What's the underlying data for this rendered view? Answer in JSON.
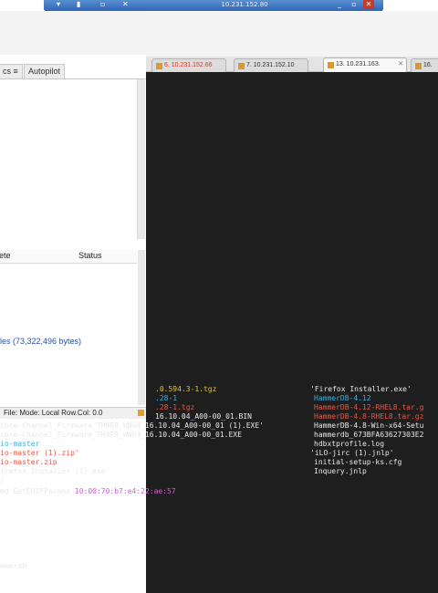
{
  "remote_bar": {
    "ip": "10.231.152.80",
    "min": "_",
    "restore": "▫",
    "close": "✕"
  },
  "left_pane": {
    "tabs": [
      "cs ≡",
      "Autopilot"
    ],
    "columns": [
      "ete",
      "Status"
    ],
    "summary": "les (73,322,496 bytes)",
    "status_bar": "File:  Mode: Local  Row.Col: 0.0"
  },
  "terminal_tabs": [
    {
      "label": "6. 10.231.152.66",
      "red": true,
      "active": false
    },
    {
      "label": "7. 10.231.152.10",
      "red": false,
      "active": false
    },
    {
      "label": "13. 10.231.163.",
      "red": false,
      "active": true
    },
    {
      "label": "16.",
      "red": false,
      "active": false
    }
  ],
  "terminal": {
    "left_lines": [
      {
        "text": ".0.594.3-1.tgz",
        "color": "y"
      },
      {
        "text": ".28-1",
        "color": "c"
      },
      {
        "text": ".28-1.tgz",
        "color": "r"
      },
      {
        "text": "16.10.04_A00-00_01.BIN",
        "color": "w"
      },
      {
        "text": "ibre-Channel_Firmware_TH9R9_WN64_16.10.04_A00-00_01 (1).EXE'",
        "color": "w"
      },
      {
        "text": "ibre-Channel_Firmware_TH9R9_WN64_16.10.04_A00-00_01.EXE",
        "color": "w"
      },
      {
        "text": "io-master",
        "color": "c"
      },
      {
        "text": "io-master (1).zip'",
        "color": "r"
      },
      {
        "text": "io-master.zip",
        "color": "r"
      },
      {
        "text": "irefox Installer (1).exe'",
        "color": "w"
      },
      {
        "text": "/",
        "color": "w"
      }
    ],
    "right_lines": [
      {
        "text": "'Firefox Installer.exe'",
        "color": "w"
      },
      {
        "text": "HammerDB-4.12",
        "color": "c"
      },
      {
        "text": "HammerDB-4.12-RHEL8.tar.g",
        "color": "r"
      },
      {
        "text": "HammerDB-4.8-RHEL8.tar.gz",
        "color": "r"
      },
      {
        "text": "HammerDB-4.8-Win-x64-Setu",
        "color": "w"
      },
      {
        "text": "hammerdb_673BFA63627303E2",
        "color": "w"
      },
      {
        "text": "hdbxtprofile.log",
        "color": "w"
      },
      {
        "text": "'iLO-jirc (1).jnlp'",
        "color": "w"
      },
      {
        "text": "initial-setup-ks.cfg",
        "color": "w"
      },
      {
        "text": "Inquery.jnlp",
        "color": "w"
      }
    ],
    "cmd_prefix": "md GetEDIFParams ",
    "cmd_arg": "10:00:70:b7:e4:22:ae:57",
    "last_line": "mmerdb"
  }
}
